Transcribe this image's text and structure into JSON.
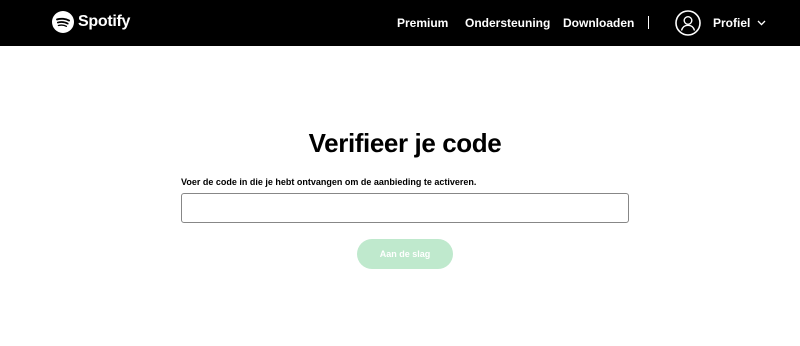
{
  "header": {
    "brand": "Spotify",
    "brand_icon": "spotify-logo-icon",
    "nav": {
      "premium": "Premium",
      "support": "Ondersteuning",
      "download": "Downloaden"
    },
    "profile": {
      "label": "Profiel",
      "avatar_icon": "user-avatar-icon",
      "chevron_icon": "chevron-down-icon"
    }
  },
  "main": {
    "title": "Verifieer je code",
    "instruction": "Voer de code in die je hebt ontvangen om de aanbieding te activeren.",
    "code_input": {
      "value": "",
      "placeholder": ""
    },
    "submit_label": "Aan de slag"
  },
  "colors": {
    "header_bg": "#000000",
    "button_disabled_bg": "#bfe9cd",
    "text": "#000000",
    "input_border": "#878787"
  }
}
